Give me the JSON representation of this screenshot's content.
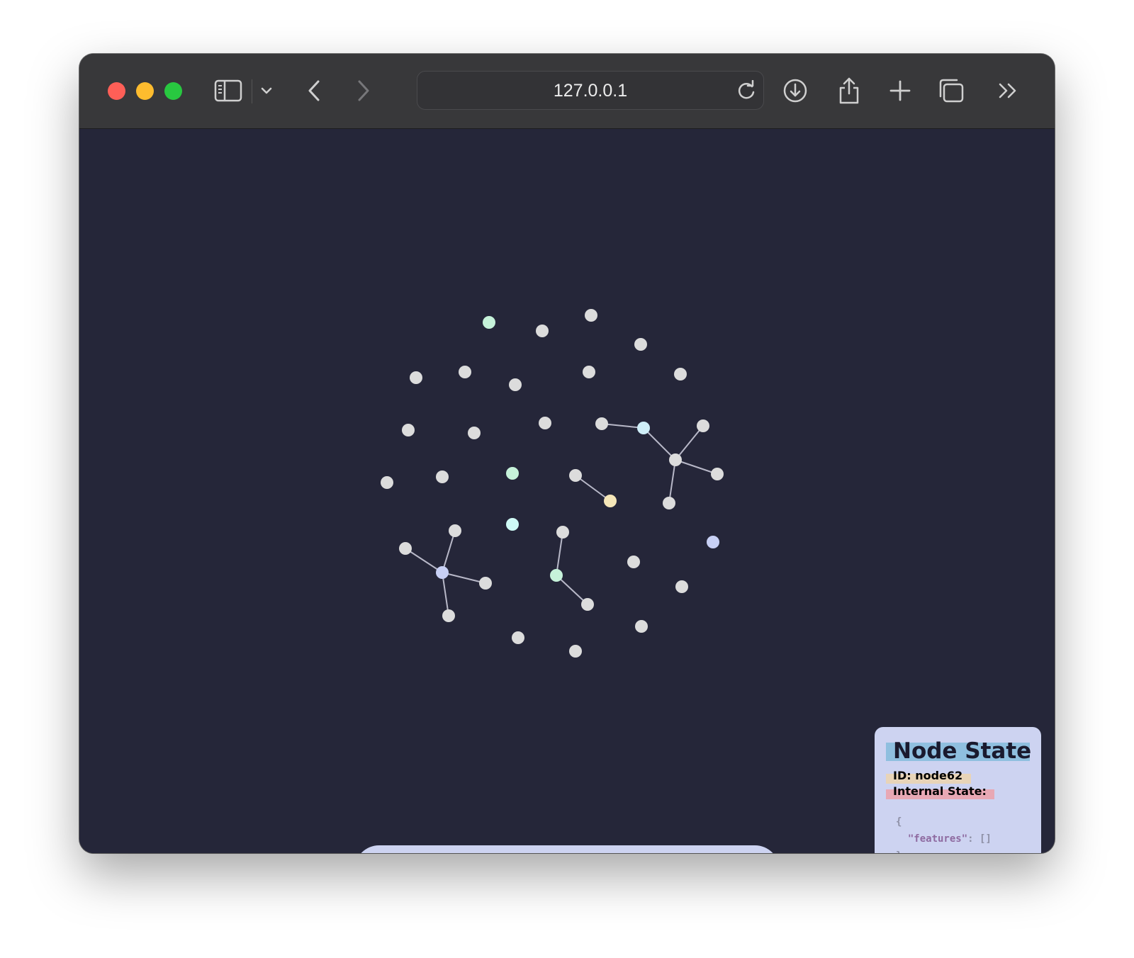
{
  "browser": {
    "address": "127.0.0.1",
    "icons": [
      "sidebar-icon",
      "chevron-down-icon",
      "back-icon",
      "forward-icon",
      "reload-icon",
      "download-icon",
      "share-icon",
      "new-tab-icon",
      "tabs-overview-icon",
      "more-icon"
    ]
  },
  "graph": {
    "colors": {
      "background": "#252639",
      "default_node": "#dcdcdc",
      "edge": "#b8b8c8",
      "mint": "#c6f2da",
      "light_blue": "#cfeef8",
      "periwinkle": "#c8d0f5",
      "cream": "#f5e6b8",
      "cyan": "#cffaf6"
    }
  },
  "pager": {
    "prev_icon": "chevron-left-icon",
    "next_icon": "chevron-right-icon"
  },
  "panel": {
    "title": "Node State",
    "id_line": "ID: node62",
    "state_label": "Internal State:",
    "json_open": "{",
    "json_key": "\"features\"",
    "json_rest": ": []",
    "json_close": "}"
  }
}
